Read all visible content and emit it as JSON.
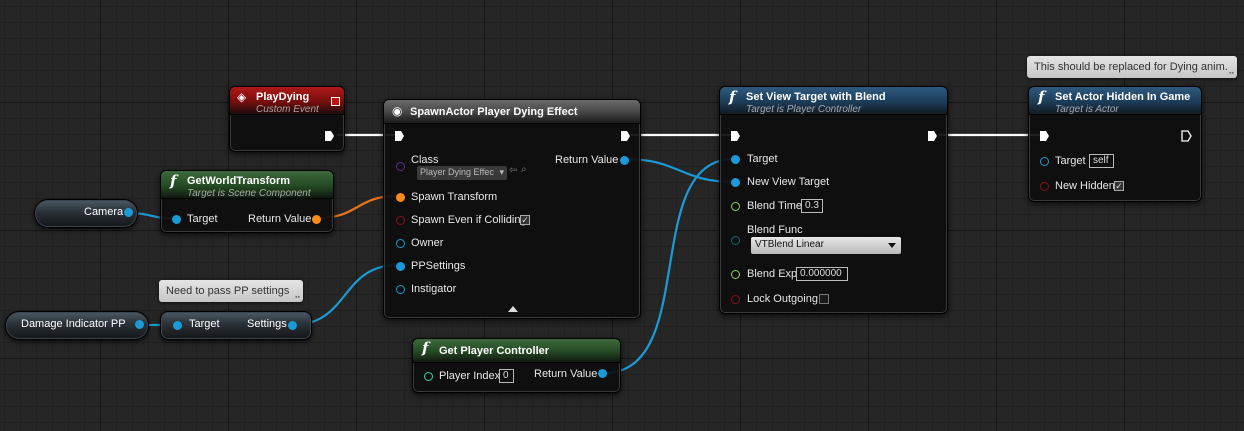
{
  "colors": {
    "exec": "#ffffff",
    "struct": "#ff8c1a",
    "object": "#1a9bd8",
    "float": "#8fd06a",
    "int": "#2fd4a2",
    "bool": "#8b1010",
    "class": "#5d2c9a",
    "byte": "#0d6b6b",
    "wire": "#1a9bd8",
    "wire_struct": "#e8731c"
  },
  "nodes": {
    "play_dying": {
      "title": "PlayDying",
      "subtitle": "Custom Event"
    },
    "get_world_transform": {
      "title": "GetWorldTransform",
      "subtitle": "Target is Scene Component",
      "target": "Target",
      "return_value": "Return Value"
    },
    "camera": {
      "label": "Camera"
    },
    "damage_pp": {
      "label": "Damage Indicator PP"
    },
    "break_pp": {
      "target": "Target",
      "settings": "Settings"
    },
    "spawn_actor": {
      "title": "SpawnActor Player Dying Effect",
      "class_label": "Class",
      "class_value": "Player Dying Effec",
      "return_value": "Return Value",
      "spawn_transform": "Spawn Transform",
      "spawn_even_if_colliding": "Spawn Even if Colliding",
      "spawn_even_if_colliding_checked": true,
      "owner": "Owner",
      "pp_settings": "PPSettings",
      "instigator": "Instigator"
    },
    "get_player_controller": {
      "title": "Get Player Controller",
      "player_index": "Player Index",
      "player_index_value": "0",
      "return_value": "Return Value"
    },
    "set_view_target": {
      "title": "Set View Target with Blend",
      "subtitle": "Target is Player Controller",
      "target": "Target",
      "new_view_target": "New View Target",
      "blend_time": "Blend Time",
      "blend_time_value": "0.3",
      "blend_func": "Blend Func",
      "blend_func_value": "VTBlend Linear",
      "blend_exp": "Blend Exp",
      "blend_exp_value": "0.000000",
      "lock_outgoing": "Lock Outgoing",
      "lock_outgoing_checked": false
    },
    "set_hidden": {
      "title": "Set Actor Hidden In Game",
      "subtitle": "Target is Actor",
      "target": "Target",
      "target_value": "self",
      "new_hidden": "New Hidden",
      "new_hidden_checked": true
    }
  },
  "comments": {
    "pp_settings": "Need to pass PP settings",
    "dying_anim": "This should be replaced for Dying anim."
  },
  "icons": {
    "function": "f",
    "event": "event-diamond-icon",
    "spawn": "spawn-actor-icon",
    "expand": "expand-arrow-icon"
  }
}
